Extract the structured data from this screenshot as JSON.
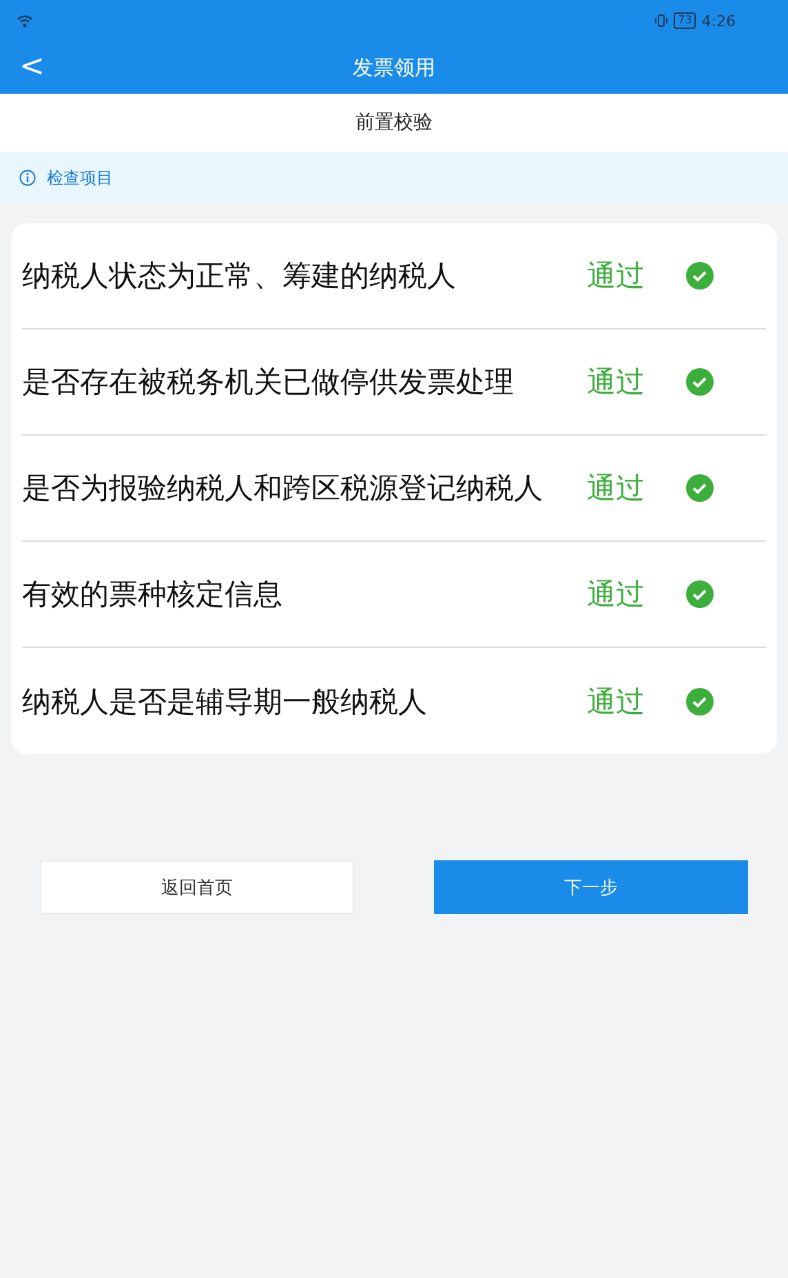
{
  "status_bar": {
    "battery": "73",
    "time": "4:26"
  },
  "nav": {
    "back": "<",
    "title": "发票领用"
  },
  "subtitle": "前置校验",
  "section": {
    "title": "检查项目"
  },
  "checks": [
    {
      "label": "纳税人状态为正常、筹建的纳税人",
      "result": "通过",
      "passed": true
    },
    {
      "label": "是否存在被税务机关已做停供发票处理",
      "result": "通过",
      "passed": true
    },
    {
      "label": "是否为报验纳税人和跨区税源登记纳税人",
      "result": "通过",
      "passed": true
    },
    {
      "label": "有效的票种核定信息",
      "result": "通过",
      "passed": true
    },
    {
      "label": "纳税人是否是辅导期一般纳税人",
      "result": "通过",
      "passed": true
    }
  ],
  "buttons": [
    {
      "label": "返回首页",
      "kind": "secondary"
    },
    {
      "label": "下一步",
      "kind": "primary"
    }
  ]
}
